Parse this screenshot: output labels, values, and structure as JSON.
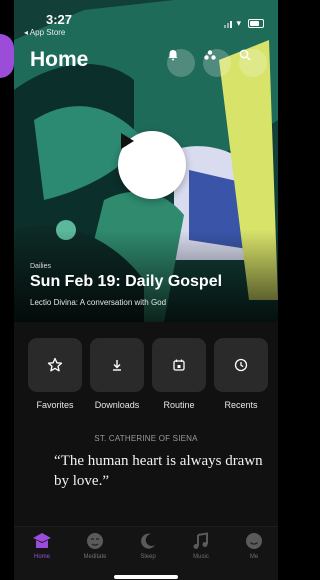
{
  "status": {
    "time": "3:27",
    "back_label": "◂ App Store"
  },
  "header": {
    "title": "Home",
    "icons": [
      "bell-icon",
      "community-icon",
      "search-icon"
    ]
  },
  "hero": {
    "eyebrow": "Dailies",
    "title": "Sun Feb 19: Daily Gospel",
    "subtitle": "Lectio Divina: A conversation with God",
    "play_icon": "play-icon"
  },
  "actions": [
    {
      "label": "Favorites",
      "icon": "star-icon"
    },
    {
      "label": "Downloads",
      "icon": "download-icon"
    },
    {
      "label": "Routine",
      "icon": "calendar-icon"
    },
    {
      "label": "Recents",
      "icon": "clock-icon"
    }
  ],
  "quote": {
    "author": "ST. CATHERINE OF SIENA",
    "text": "“The human heart is always drawn by love.”"
  },
  "tabbar": {
    "active": "Home",
    "tabs": [
      {
        "label": "Home",
        "icon": "home-icon"
      },
      {
        "label": "Meditate",
        "icon": "meditate-icon"
      },
      {
        "label": "Sleep",
        "icon": "moon-icon"
      },
      {
        "label": "Music",
        "icon": "music-icon"
      },
      {
        "label": "Me",
        "icon": "profile-icon"
      }
    ]
  },
  "colors": {
    "accent": "#9b4dd9",
    "hero_green": "#0f3a33",
    "tile": "#2a2a2a"
  }
}
